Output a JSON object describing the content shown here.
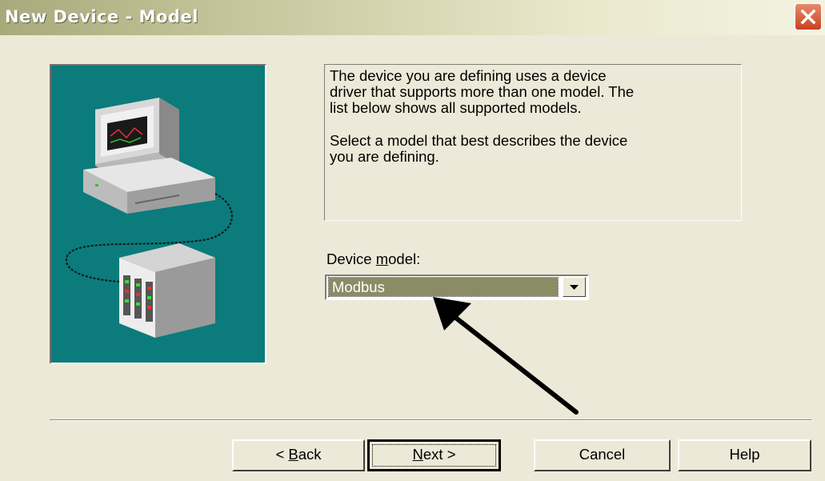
{
  "window": {
    "title": "New Device - Model"
  },
  "description": {
    "paragraph1_lines": [
      "The device you are defining uses a device",
      "driver that supports more than one model.  The",
      "list below shows all supported models."
    ],
    "paragraph2_lines": [
      "Select  a model that best describes the device",
      "you are defining."
    ]
  },
  "device_model": {
    "label_pre": "Device ",
    "label_accel": "m",
    "label_post": "odel:",
    "selected": "Modbus"
  },
  "buttons": {
    "back": {
      "pre": "< ",
      "accel": "B",
      "post": "ack"
    },
    "next": {
      "pre": "",
      "accel": "N",
      "post": "ext >"
    },
    "cancel": "Cancel",
    "help": "Help"
  },
  "colors": {
    "art_background": "#0b7b7b",
    "selection": "#8b8c66",
    "dialog": "#ece9d8"
  },
  "icons": [
    "close-icon",
    "computer-icon",
    "device-rack-icon",
    "dropdown-arrow-icon",
    "pointer-arrow-icon"
  ]
}
